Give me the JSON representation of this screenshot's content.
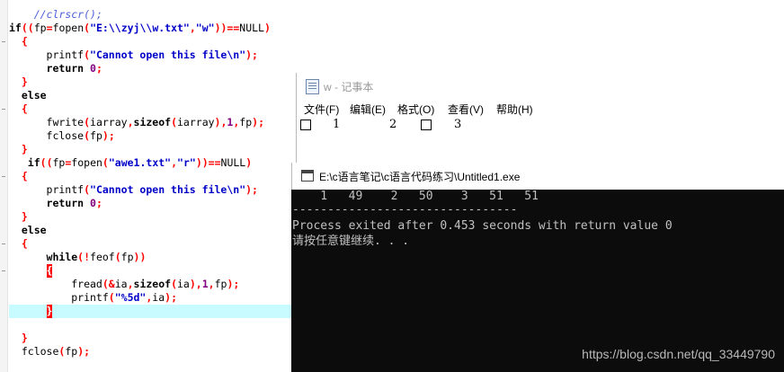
{
  "editor": {
    "lines": [
      [
        {
          "t": "    ",
          "c": ""
        },
        {
          "t": "//clrscr();",
          "c": "cmt"
        }
      ],
      [
        {
          "t": "if",
          "c": "kw"
        },
        {
          "t": "((",
          "c": "op"
        },
        {
          "t": "fp",
          "c": ""
        },
        {
          "t": "=",
          "c": "op"
        },
        {
          "t": "fopen",
          "c": ""
        },
        {
          "t": "(",
          "c": "op"
        },
        {
          "t": "\"E:\\\\zyj\\\\w.txt\"",
          "c": "str"
        },
        {
          "t": ",",
          "c": "op"
        },
        {
          "t": "\"w\"",
          "c": "str"
        },
        {
          "t": "))==",
          "c": "op"
        },
        {
          "t": "NULL",
          "c": ""
        },
        {
          "t": ")",
          "c": "op"
        }
      ],
      [
        {
          "t": "  ",
          "c": ""
        },
        {
          "t": "{",
          "c": "brace"
        }
      ],
      [
        {
          "t": "      printf",
          "c": ""
        },
        {
          "t": "(",
          "c": "op"
        },
        {
          "t": "\"Cannot open this file\\n\"",
          "c": "str"
        },
        {
          "t": ");",
          "c": "op"
        }
      ],
      [
        {
          "t": "      ",
          "c": ""
        },
        {
          "t": "return",
          "c": "kw"
        },
        {
          "t": " ",
          "c": ""
        },
        {
          "t": "0",
          "c": "num"
        },
        {
          "t": ";",
          "c": "op"
        }
      ],
      [
        {
          "t": "  ",
          "c": ""
        },
        {
          "t": "}",
          "c": "brace"
        }
      ],
      [
        {
          "t": "  ",
          "c": ""
        },
        {
          "t": "else",
          "c": "kw"
        }
      ],
      [
        {
          "t": "  ",
          "c": ""
        },
        {
          "t": "{",
          "c": "brace"
        }
      ],
      [
        {
          "t": "      fwrite",
          "c": ""
        },
        {
          "t": "(",
          "c": "op"
        },
        {
          "t": "iarray",
          "c": ""
        },
        {
          "t": ",",
          "c": "op"
        },
        {
          "t": "sizeof",
          "c": "kw"
        },
        {
          "t": "(",
          "c": "op"
        },
        {
          "t": "iarray",
          "c": ""
        },
        {
          "t": "),",
          "c": "op"
        },
        {
          "t": "1",
          "c": "num"
        },
        {
          "t": ",",
          "c": "op"
        },
        {
          "t": "fp",
          "c": ""
        },
        {
          "t": ");",
          "c": "op"
        }
      ],
      [
        {
          "t": "      fclose",
          "c": ""
        },
        {
          "t": "(",
          "c": "op"
        },
        {
          "t": "fp",
          "c": ""
        },
        {
          "t": ");",
          "c": "op"
        }
      ],
      [
        {
          "t": "  ",
          "c": ""
        },
        {
          "t": "}",
          "c": "brace"
        }
      ],
      [
        {
          "t": "   ",
          "c": ""
        },
        {
          "t": "if",
          "c": "kw"
        },
        {
          "t": "((",
          "c": "op"
        },
        {
          "t": "fp",
          "c": ""
        },
        {
          "t": "=",
          "c": "op"
        },
        {
          "t": "fopen",
          "c": ""
        },
        {
          "t": "(",
          "c": "op"
        },
        {
          "t": "\"awe1.txt\"",
          "c": "str"
        },
        {
          "t": ",",
          "c": "op"
        },
        {
          "t": "\"r\"",
          "c": "str"
        },
        {
          "t": "))==",
          "c": "op"
        },
        {
          "t": "NULL",
          "c": ""
        },
        {
          "t": ")",
          "c": "op"
        }
      ],
      [
        {
          "t": "  ",
          "c": ""
        },
        {
          "t": "{",
          "c": "brace"
        }
      ],
      [
        {
          "t": "      printf",
          "c": ""
        },
        {
          "t": "(",
          "c": "op"
        },
        {
          "t": "\"Cannot open this file\\n\"",
          "c": "str"
        },
        {
          "t": ");",
          "c": "op"
        }
      ],
      [
        {
          "t": "      ",
          "c": ""
        },
        {
          "t": "return",
          "c": "kw"
        },
        {
          "t": " ",
          "c": ""
        },
        {
          "t": "0",
          "c": "num"
        },
        {
          "t": ";",
          "c": "op"
        }
      ],
      [
        {
          "t": "  ",
          "c": ""
        },
        {
          "t": "}",
          "c": "brace"
        }
      ],
      [
        {
          "t": "  ",
          "c": ""
        },
        {
          "t": "else",
          "c": "kw"
        }
      ],
      [
        {
          "t": "  ",
          "c": ""
        },
        {
          "t": "{",
          "c": "brace"
        }
      ],
      [
        {
          "t": "      ",
          "c": ""
        },
        {
          "t": "while",
          "c": "kw"
        },
        {
          "t": "(!",
          "c": "op"
        },
        {
          "t": "feof",
          "c": ""
        },
        {
          "t": "(",
          "c": "op"
        },
        {
          "t": "fp",
          "c": ""
        },
        {
          "t": "))",
          "c": "op"
        }
      ],
      [
        {
          "t": "      ",
          "c": ""
        },
        {
          "t": "{",
          "c": "bm"
        }
      ],
      [
        {
          "t": "          fread",
          "c": ""
        },
        {
          "t": "(&",
          "c": "op"
        },
        {
          "t": "ia",
          "c": ""
        },
        {
          "t": ",",
          "c": "op"
        },
        {
          "t": "sizeof",
          "c": "kw"
        },
        {
          "t": "(",
          "c": "op"
        },
        {
          "t": "ia",
          "c": ""
        },
        {
          "t": "),",
          "c": "op"
        },
        {
          "t": "1",
          "c": "num"
        },
        {
          "t": ",",
          "c": "op"
        },
        {
          "t": "fp",
          "c": ""
        },
        {
          "t": ");",
          "c": "op"
        }
      ],
      [
        {
          "t": "          printf",
          "c": ""
        },
        {
          "t": "(",
          "c": "op"
        },
        {
          "t": "\"%5d\"",
          "c": "str"
        },
        {
          "t": ",",
          "c": "op"
        },
        {
          "t": "ia",
          "c": ""
        },
        {
          "t": ");",
          "c": "op"
        }
      ],
      [
        {
          "t": "      ",
          "c": ""
        },
        {
          "t": "}",
          "c": "bm"
        }
      ],
      [
        {
          "t": "",
          "c": ""
        }
      ],
      [
        {
          "t": "  ",
          "c": ""
        },
        {
          "t": "}",
          "c": "brace"
        }
      ],
      [
        {
          "t": "  fclose",
          "c": ""
        },
        {
          "t": "(",
          "c": "op"
        },
        {
          "t": "fp",
          "c": ""
        },
        {
          "t": ");",
          "c": "op"
        }
      ]
    ]
  },
  "notepad": {
    "title": "w - 记事本",
    "menu": [
      "文件(F)",
      "编辑(E)",
      "格式(O)",
      "查看(V)",
      "帮助(H)"
    ],
    "content": {
      "digits": [
        "1",
        "2",
        "3"
      ]
    },
    "icon": "notepad-icon"
  },
  "console": {
    "title": "E:\\c语言笔记\\c语言代码练习\\Untitled1.exe",
    "lines": [
      "    1   49    2   50    3   51   51",
      "--------------------------------",
      "Process exited after 0.453 seconds with return value 0",
      "请按任意键继续. . ."
    ],
    "icon": "console-icon"
  },
  "watermark": "https://blog.csdn.net/qq_33449790"
}
